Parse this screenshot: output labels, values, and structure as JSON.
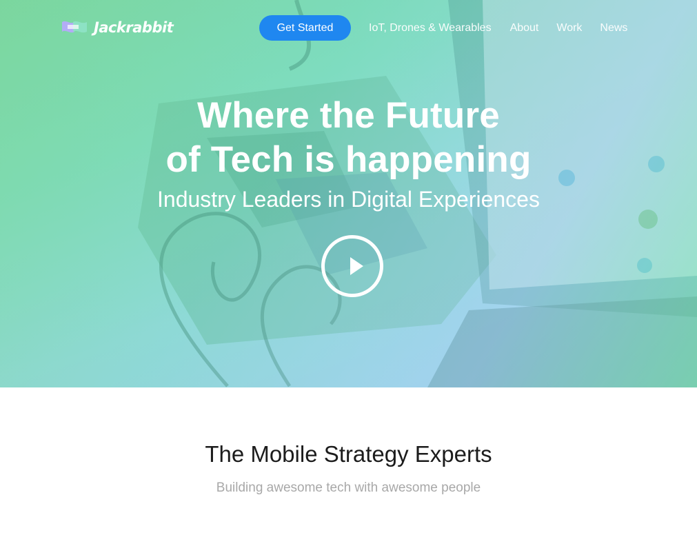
{
  "brand": {
    "name": "Jackrabbit",
    "logo_icon": "jackrabbit-flag-icon"
  },
  "nav": {
    "cta_label": "Get Started",
    "links": [
      "IoT, Drones & Wearables",
      "About",
      "Work",
      "News"
    ]
  },
  "hero": {
    "headline_line1": "Where the Future",
    "headline_line2": "of Tech is happening",
    "subhead": "Industry Leaders in Digital Experiences",
    "play_icon": "play-icon"
  },
  "section": {
    "title": "The Mobile Strategy Experts",
    "subtitle": "Building awesome tech with awesome people"
  },
  "colors": {
    "cta": "#1f87f0",
    "hero_tint_green": "#7fd6a8",
    "hero_tint_blue": "#a9c8ef",
    "text_dark": "#1c1c1c",
    "text_muted": "#a8a8a8"
  }
}
